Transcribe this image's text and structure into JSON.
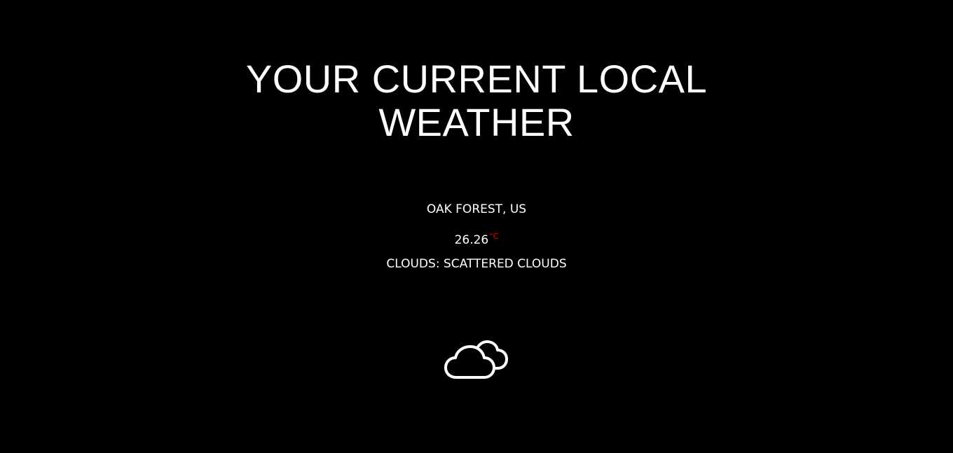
{
  "header": {
    "title_line1": "YOUR CURRENT LOCAL",
    "title_line2": "WEATHER"
  },
  "weather": {
    "location": "OAK FOREST, US",
    "temperature": "26.26",
    "temperature_unit": "°C",
    "description": "CLOUDS: SCATTERED CLOUDS",
    "icon": "scattered-clouds-icon"
  },
  "colors": {
    "background": "#000000",
    "text": "#ffffff",
    "unit_accent": "#ff0000"
  }
}
